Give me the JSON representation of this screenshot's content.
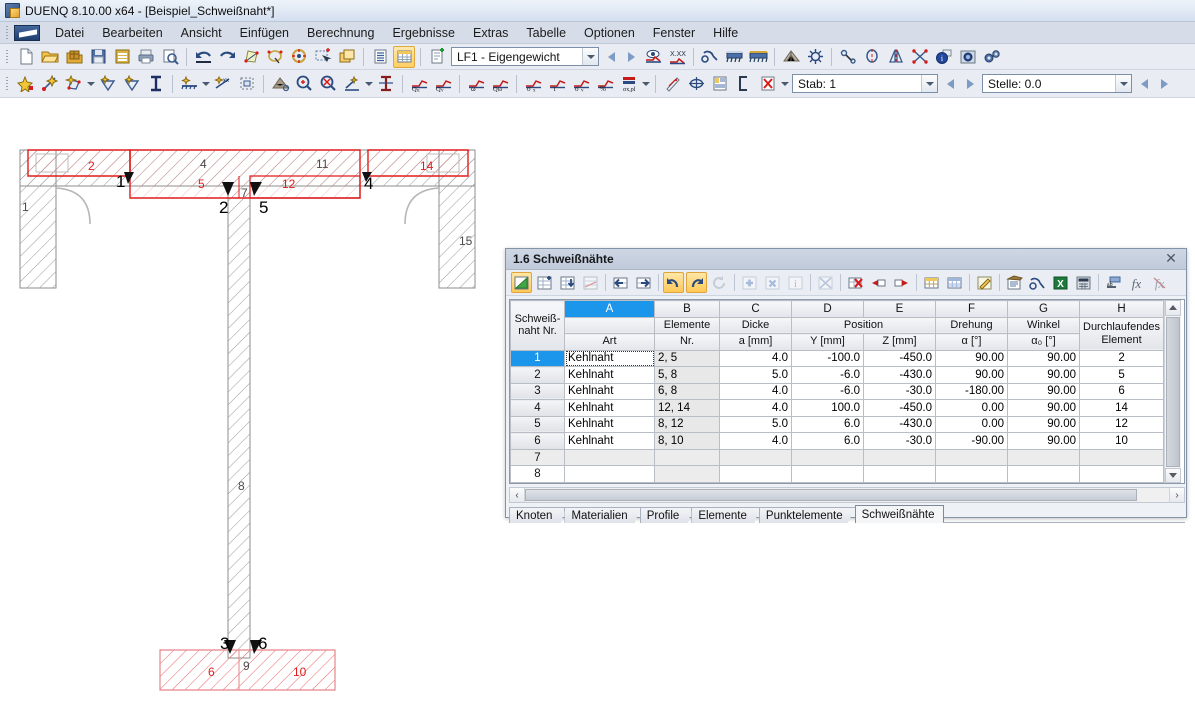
{
  "window": {
    "title": "DUENQ 8.10.00 x64 - [Beispiel_Schweißnaht*]",
    "app_icon": "duenq-app-icon"
  },
  "menubar": {
    "items": [
      {
        "label": "Datei"
      },
      {
        "label": "Bearbeiten"
      },
      {
        "label": "Ansicht"
      },
      {
        "label": "Einfügen"
      },
      {
        "label": "Berechnung"
      },
      {
        "label": "Ergebnisse"
      },
      {
        "label": "Extras"
      },
      {
        "label": "Tabelle"
      },
      {
        "label": "Optionen"
      },
      {
        "label": "Fenster"
      },
      {
        "label": "Hilfe"
      }
    ]
  },
  "toolbar_main": {
    "loadcase_combo": {
      "value": "LF1 - Eigengewicht"
    }
  },
  "toolbar_second": {
    "member_combo": {
      "value": "Stab: 1"
    },
    "location_combo": {
      "value": "Stelle: 0.0"
    }
  },
  "dialog": {
    "title": "1.6 Schweißnähte",
    "close_label": "✕",
    "table": {
      "column_letters": [
        "A",
        "B",
        "C",
        "D",
        "E",
        "F",
        "G",
        "H"
      ],
      "selected_column": "A",
      "corner_label_line1": "Schweiß-",
      "corner_label_line2": "naht Nr.",
      "headers": [
        {
          "top": "",
          "bottom": "Art"
        },
        {
          "top": "Elemente",
          "bottom": "Nr."
        },
        {
          "top": "Dicke",
          "bottom": "a [mm]"
        },
        {
          "top": "Position",
          "bottom": "Y [mm]"
        },
        {
          "top": "",
          "bottom": "Z [mm]"
        },
        {
          "top": "Drehung",
          "bottom": "α [°]"
        },
        {
          "top": "Winkel",
          "bottom": "α₀ [°]"
        },
        {
          "top": "Durchlaufendes",
          "bottom": "Element"
        }
      ],
      "group_header_position": "Position",
      "rows": [
        {
          "nr": "1",
          "art": "Kehlnaht",
          "elemente": "2, 5",
          "dicke": "4.0",
          "y": "-100.0",
          "z": "-450.0",
          "drehung": "90.00",
          "winkel": "90.00",
          "durchlaufend": "2"
        },
        {
          "nr": "2",
          "art": "Kehlnaht",
          "elemente": "5, 8",
          "dicke": "5.0",
          "y": "-6.0",
          "z": "-430.0",
          "drehung": "90.00",
          "winkel": "90.00",
          "durchlaufend": "5"
        },
        {
          "nr": "3",
          "art": "Kehlnaht",
          "elemente": "6, 8",
          "dicke": "4.0",
          "y": "-6.0",
          "z": "-30.0",
          "drehung": "-180.00",
          "winkel": "90.00",
          "durchlaufend": "6"
        },
        {
          "nr": "4",
          "art": "Kehlnaht",
          "elemente": "12, 14",
          "dicke": "4.0",
          "y": "100.0",
          "z": "-450.0",
          "drehung": "0.00",
          "winkel": "90.00",
          "durchlaufend": "14"
        },
        {
          "nr": "5",
          "art": "Kehlnaht",
          "elemente": "8, 12",
          "dicke": "5.0",
          "y": "6.0",
          "z": "-430.0",
          "drehung": "0.00",
          "winkel": "90.00",
          "durchlaufend": "12"
        },
        {
          "nr": "6",
          "art": "Kehlnaht",
          "elemente": "8, 10",
          "dicke": "4.0",
          "y": "6.0",
          "z": "-30.0",
          "drehung": "-90.00",
          "winkel": "90.00",
          "durchlaufend": "10"
        },
        {
          "nr": "7",
          "art": "",
          "elemente": "",
          "dicke": "",
          "y": "",
          "z": "",
          "drehung": "",
          "winkel": "",
          "durchlaufend": ""
        },
        {
          "nr": "8",
          "art": "",
          "elemente": "",
          "dicke": "",
          "y": "",
          "z": "",
          "drehung": "",
          "winkel": "",
          "durchlaufend": ""
        }
      ]
    },
    "tabs": [
      {
        "label": "Knoten",
        "active": false
      },
      {
        "label": "Materialien",
        "active": false
      },
      {
        "label": "Profile",
        "active": false
      },
      {
        "label": "Elemente",
        "active": false
      },
      {
        "label": "Punktelemente",
        "active": false
      },
      {
        "label": "Schweißnähte",
        "active": true
      }
    ]
  },
  "drawing": {
    "black_labels": [
      "1",
      "2",
      "5",
      "4",
      "3",
      "6"
    ],
    "grey_labels": [
      "1",
      "4",
      "11",
      "15",
      "8",
      "9",
      "7"
    ],
    "red_labels": [
      "2",
      "5",
      "12",
      "14",
      "6",
      "10"
    ],
    "description": "I-beam cross-section with hatched flanges and web, red weld-seam overlays"
  },
  "colors": {
    "accent": "#1c96eb",
    "weld_red": "#e01b1b",
    "title_bar": "#dee7f3",
    "toolbar_bg": "#e9edf3",
    "dialog_title": "#c6cfdd"
  }
}
